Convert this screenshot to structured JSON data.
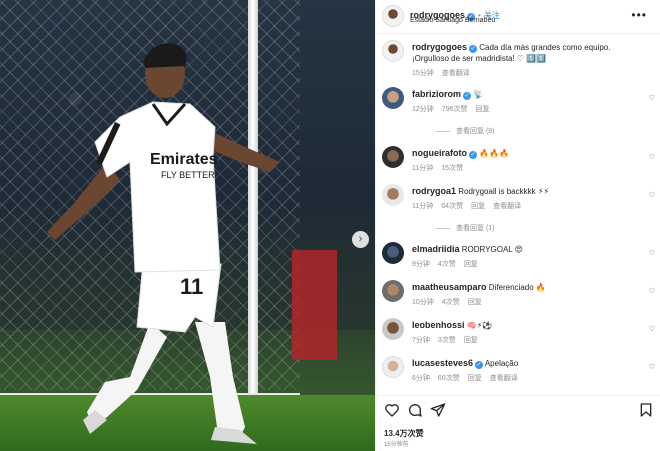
{
  "header": {
    "username": "rodrygogoes",
    "follow_label": "关注",
    "dot": "•",
    "location": "Estadio Santiago Bernabéu",
    "more": "•••"
  },
  "caption": {
    "username": "rodrygogoes",
    "text": "Cada día más grandes como equipo. ¡Orgulloso de ser madridista! ♡ 1️⃣1️⃣",
    "time": "15分钟",
    "translate": "查看翻译"
  },
  "comments": [
    {
      "username": "fabriziorom",
      "text": "📡",
      "time": "12分钟",
      "likes": "796次赞",
      "reply": "回复",
      "translate": "",
      "view_replies": "查看回复 (9)"
    },
    {
      "username": "nogueirafoto",
      "text": "🔥🔥🔥",
      "time": "11分钟",
      "likes": "15次赞",
      "reply": "回复",
      "translate": "",
      "view_replies": ""
    },
    {
      "username": "rodrygoa1",
      "text": "Rodrygoall is backkkk ⚡⚡",
      "time": "11分钟",
      "likes": "64次赞",
      "reply": "回复",
      "translate": "查看翻译",
      "view_replies": "查看回复 (1)"
    },
    {
      "username": "elmadriidia",
      "text": "RODRYGOAL 😍",
      "time": "9分钟",
      "likes": "4次赞",
      "reply": "回复",
      "translate": "",
      "view_replies": ""
    },
    {
      "username": "maatheusamparo",
      "text": "Diferenciado 🔥",
      "time": "10分钟",
      "likes": "4次赞",
      "reply": "回复",
      "translate": "",
      "view_replies": ""
    },
    {
      "username": "leobenhossi",
      "text": "🧠⚡⚽",
      "time": "7分钟",
      "likes": "3次赞",
      "reply": "回复",
      "translate": "",
      "view_replies": ""
    },
    {
      "username": "lucasesteves6",
      "text": "Apelação",
      "time": "6分钟",
      "likes": "60次赞",
      "reply": "回复",
      "translate": "查看翻译",
      "view_replies": ""
    }
  ],
  "footer": {
    "likes": "13.4万次赞",
    "time": "15分钟前"
  },
  "media": {
    "jersey_sponsor": "Emirates FLY BETTER",
    "jersey_number": "11"
  },
  "colors": {
    "accent": "#0095f6",
    "verified": "#3897f0",
    "muted": "#8e8e8e"
  }
}
